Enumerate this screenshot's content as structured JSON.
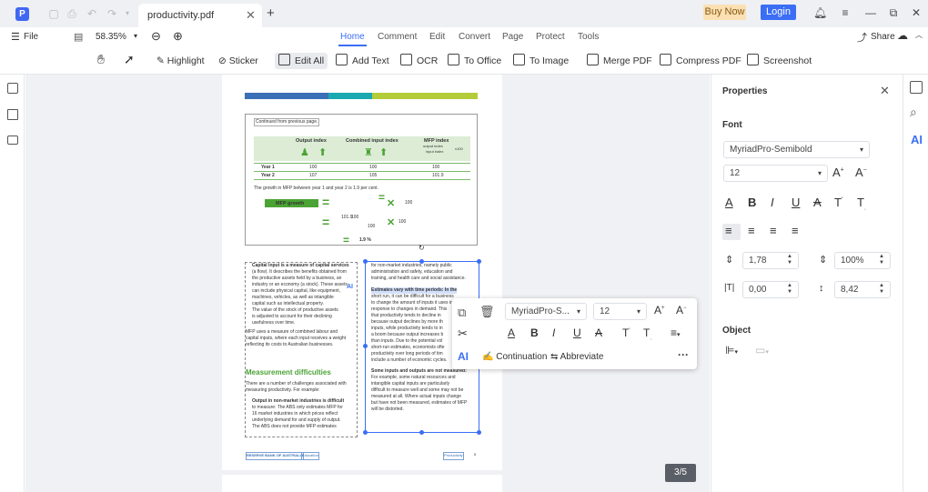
{
  "titlebar": {
    "app_logo": "P",
    "tab_title": "productivity.pdf",
    "tab_close": "✕",
    "new_tab": "+",
    "buy_now": "Buy Now",
    "login": "Login"
  },
  "menubar": {
    "file": "File",
    "zoom": "58.35%",
    "tabs": [
      "Home",
      "Comment",
      "Edit",
      "Convert",
      "Page",
      "Protect",
      "Tools"
    ],
    "active_tab": "Home",
    "share": "Share"
  },
  "ribbon": {
    "highlight": "Highlight",
    "sticker": "Sticker",
    "edit_all": "Edit All",
    "add_text": "Add Text",
    "ocr": "OCR",
    "to_office": "To Office",
    "to_image": "To Image",
    "merge_pdf": "Merge PDF",
    "compress_pdf": "Compress PDF",
    "screenshot": "Screenshot"
  },
  "properties": {
    "title": "Properties",
    "font_label": "Font",
    "font_family": "MyriadPro-Semibold",
    "font_size": "12",
    "line_spacing": "1,78",
    "scale": "100%",
    "char_spacing": "0,00",
    "line_height": "8,42",
    "object_label": "Object"
  },
  "floating_toolbar": {
    "font_family": "MyriadPro-S...",
    "font_size": "12",
    "continuation": "Continuation",
    "abbreviate": "Abbreviate",
    "ai": "AI"
  },
  "page_counter": "3/5",
  "document": {
    "continued": "Continued from previous page.",
    "col_output": "Output index",
    "col_combined": "Combined input index",
    "col_mfp": "MFP index",
    "mfp_formula": "output index",
    "mfp_formula2": "input index",
    "mfp_formula3": "x100",
    "row1": [
      "Year 1",
      "100",
      "100",
      "100"
    ],
    "row2": [
      "Year 2",
      "107",
      "105",
      "101.9"
    ],
    "growth_note": "The growth in MFP between year 1 and year 2 is 1.9 per cent.",
    "mfp_growth": "MFP growth",
    "eq_1019": "101.9",
    "eq_100a": "100",
    "eq_100b": "100",
    "eq_100c": "100",
    "eq_100d": "100",
    "result": "1.9 %",
    "ai_tag": "AI",
    "left_col": [
      "Capital input is a measure of capital services",
      "(a flow). It describes the benefits obtained from",
      "the productive assets held by a business, an",
      "industry or an economy (a stock). These assets",
      "can include physical capital, like equipment,",
      "machines, vehicles, as well as intangible",
      "capital such as intellectual property.",
      "The value of the stock of productive assets",
      "is adjusted to account for their declining",
      "usefulness over time.",
      "MFP uses a measure of combined labour and",
      "capital inputs, where each input receives a weight",
      "reflecting its costs to Australian businesses."
    ],
    "heading": "Measurement difficulties",
    "left_col2": [
      "There are a number of challenges associated with",
      "measuring productivity. For example:",
      "Output in non-market industries is difficult",
      "to measure: The ABS only estimates MFP for",
      "16 market industries in which prices reflect",
      "underlying demand for and supply of output.",
      "The ABS does not provide MFP estimates"
    ],
    "right_col": [
      "for non-market industries, namely public",
      "administration and safety, education and",
      "training, and health care and social assistance.",
      "Estimates vary with time periods: In the",
      "short run, it can be difficult for a business",
      "to change the amount of inputs it uses in",
      "response to changes in demand. This",
      "that productivity tends to decline in",
      "because output declines by more th",
      "inputs, while productivity tends to in",
      "a boom because output increases b",
      "than inputs. Due to the potential vol",
      "short-run estimates, economists ofte",
      "productivity over long periods of tim",
      "include a number of economic cycles.",
      "Some inputs and outputs are not measured:",
      "For example, some natural resources and",
      "intangible capital inputs are particularly",
      "difficult to measure well and some may not be",
      "measured at all. Where actual inputs change",
      "but have not been measured, estimates of MFP",
      "will be distorted."
    ],
    "footer_left": "RESERVE BANK OF AUSTRALIA",
    "footer_tag": "Education",
    "footer_right": "Productivity",
    "footer_num": "5"
  },
  "colors": {
    "accent": "#3b6ef5",
    "green": "#4ba335",
    "bar_blue": "#3b6fb6",
    "bar_teal": "#1aa9b0",
    "bar_lime": "#b3cc3a"
  }
}
